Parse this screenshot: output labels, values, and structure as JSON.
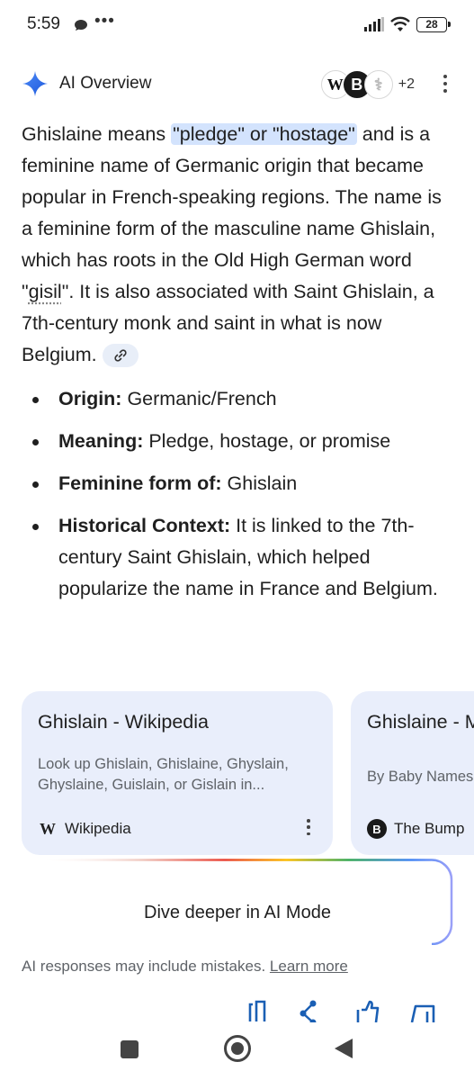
{
  "status_bar": {
    "time": "5:59",
    "dots": "•••",
    "battery": "28"
  },
  "overview": {
    "title": "AI Overview",
    "sources": {
      "w_badge": "W",
      "b_badge": "B",
      "m_badge": "⚕",
      "extra_count": "+2"
    },
    "para_1": "Ghislaine means ",
    "highlight": "\"pledge\" or \"hostage\"",
    "para_2": " and is a feminine name of Germanic origin that became popular in French-speaking regions. The name is a feminine form of the masculine name Ghislain, which has roots in the Old High German word \"",
    "dotted_word": "gisil",
    "para_3": "\". It is also associated with Saint Ghislain, a 7th-century monk and saint in what is now Belgium.",
    "bullets": [
      {
        "label": "Origin:",
        "text": " Germanic/French"
      },
      {
        "label": "Meaning:",
        "text": " Pledge, hostage, or promise"
      },
      {
        "label": "Feminine form of:",
        "text": " Ghislain"
      },
      {
        "label": "Historical Context:",
        "text": " It is linked to the 7th-century Saint Ghislain, which helped popularize the name in France and Belgium."
      }
    ]
  },
  "cards": [
    {
      "title": "Ghislain - Wikipedia",
      "snippet": "Look up Ghislain, Ghislaine, Ghyslain, Ghyslaine, Guislain, or Gislain in...",
      "source_icon": "W",
      "source": "Wikipedia"
    },
    {
      "title": "Ghislaine - Meaning, O",
      "snippet": "By Baby Names Writer. Fact Ch",
      "source_icon": "B",
      "source": "The Bump"
    }
  ],
  "dive_deeper": {
    "label": "Dive deeper in AI Mode"
  },
  "disclaimer": {
    "text": "AI responses may include mistakes. ",
    "link": "Learn more"
  },
  "actions": [
    "copy-icon",
    "share-icon",
    "thumbs-up-icon",
    "feedback-icon"
  ],
  "colors": {
    "accent_blue": "#1a73e8",
    "highlight_bg": "#d3e3fd",
    "card_bg": "#e9eefb",
    "action_blue": "#1a5fb4"
  }
}
